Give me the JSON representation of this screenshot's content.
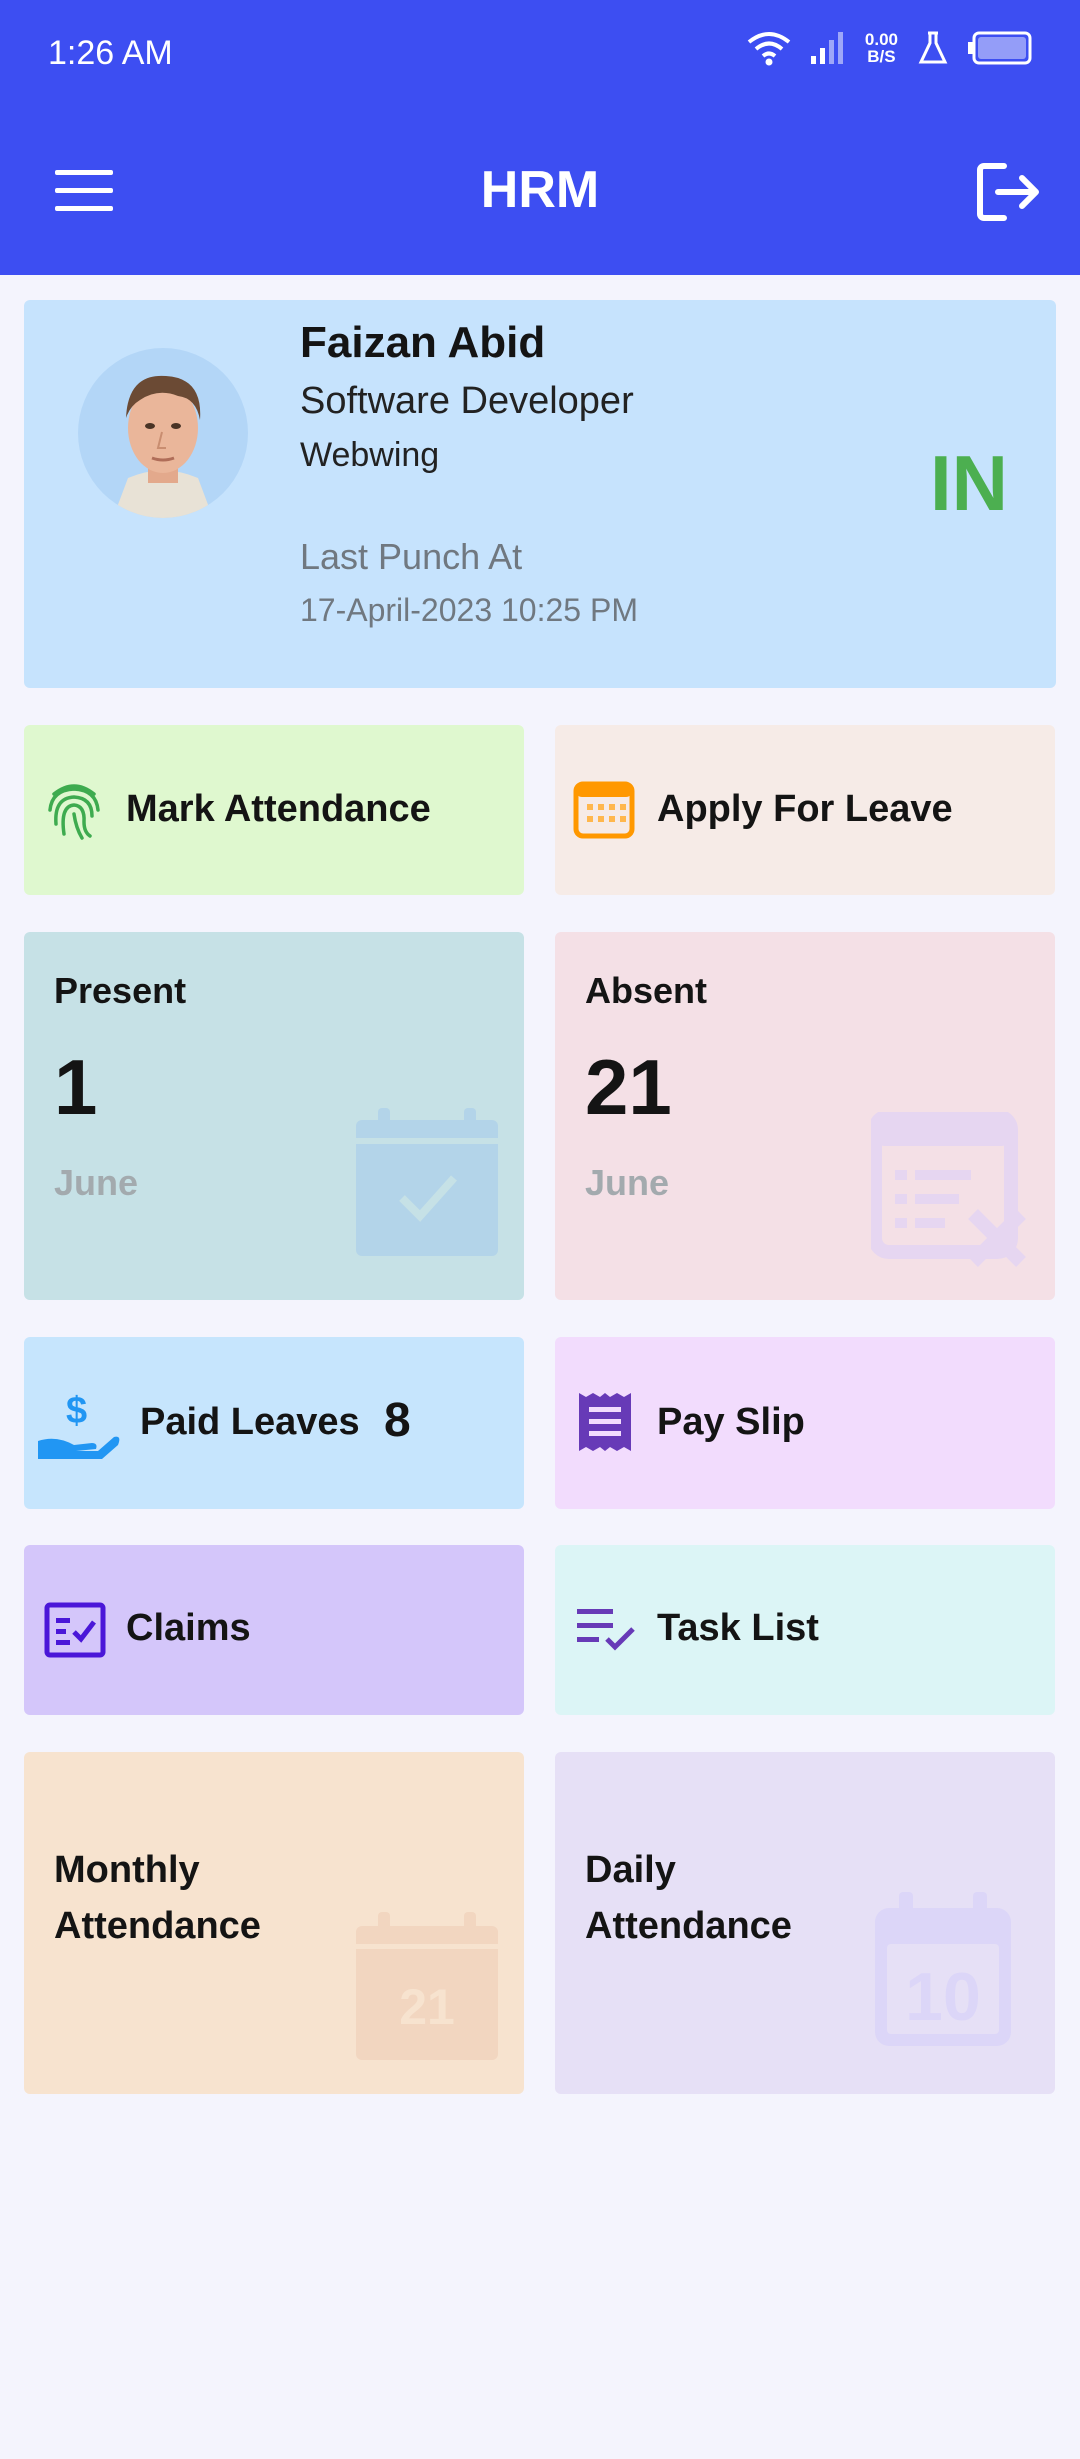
{
  "status_bar": {
    "time": "1:26 AM",
    "net_speed_value": "0.00",
    "net_speed_unit": "B/S",
    "icons": [
      "wifi-icon",
      "signal-icon",
      "lab-flask-icon",
      "battery-icon"
    ]
  },
  "app_bar": {
    "title": "HRM",
    "menu_icon": "hamburger-menu-icon",
    "logout_icon": "logout-icon",
    "color": "#3d4ef2"
  },
  "profile": {
    "name": "Faizan Abid",
    "role": "Software Developer",
    "company": "Webwing",
    "last_punch_label": "Last Punch At",
    "last_punch_time": "17-April-2023 10:25 PM",
    "status": "IN",
    "status_color": "#4caf50"
  },
  "actions": {
    "mark_attendance": "Mark Attendance",
    "apply_leave": "Apply For Leave",
    "paid_leaves_label": "Paid Leaves",
    "paid_leaves_count": "8",
    "pay_slip": "Pay Slip",
    "claims": "Claims",
    "task_list": "Task List",
    "monthly_attendance_line1": "Monthly",
    "monthly_attendance_line2": "Attendance",
    "daily_attendance_line1": "Daily",
    "daily_attendance_line2": "Attendance"
  },
  "stats": {
    "present": {
      "title": "Present",
      "value": "1",
      "month": "June"
    },
    "absent": {
      "title": "Absent",
      "value": "21",
      "month": "June"
    }
  },
  "watermark_icons": {
    "monthly_calendar_number": "21",
    "daily_calendar_number": "10"
  }
}
